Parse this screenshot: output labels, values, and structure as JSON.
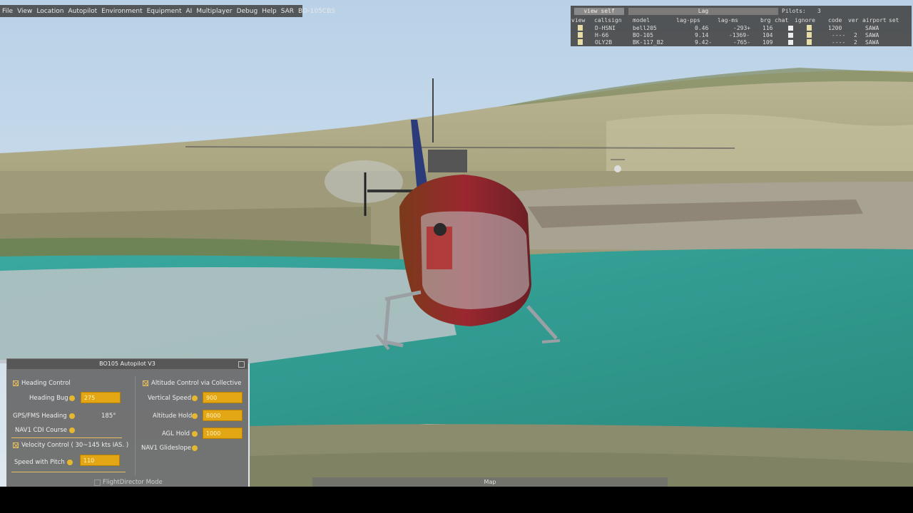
{
  "menu": [
    "File",
    "View",
    "Location",
    "Autopilot",
    "Environment",
    "Equipment",
    "AI",
    "Multiplayer",
    "Debug",
    "Help",
    "SAR",
    "BO-105CBS"
  ],
  "pilots_panel": {
    "view_self_label": "view self",
    "lag_label": "Lag",
    "pilots_label": "Pilots:",
    "pilots_count": "3",
    "columns": [
      "view",
      "callsign",
      "model",
      "lag-pps",
      "lag-ms",
      "brg",
      "chat",
      "ignore",
      "code",
      "ver",
      "airport",
      "set"
    ],
    "rows": [
      {
        "callsign": "D-HSNI",
        "model": "bell205",
        "lag_pps": "0.46",
        "lag_ms": "-293+",
        "brg": "116",
        "code": "1200",
        "ver": "",
        "airport": "SAWA"
      },
      {
        "callsign": "H-66",
        "model": "BO-105",
        "lag_pps": "9.14",
        "lag_ms": "-1369-",
        "brg": "104",
        "code": "----",
        "ver": "2",
        "airport": "SAWA"
      },
      {
        "callsign": "OLY2B",
        "model": "BK-117_B2",
        "lag_pps": "9.42-",
        "lag_ms": "-765-",
        "brg": "109",
        "code": "----",
        "ver": "2",
        "airport": "SAWA"
      }
    ]
  },
  "autopilot": {
    "title": "BO105 Autopilot V3",
    "heading_control": "Heading Control",
    "heading_bug_label": "Heading Bug",
    "heading_bug_value": "275",
    "gps_heading_label": "GPS/FMS Heading",
    "gps_heading_value": "185°",
    "nav1_cdi_label": "NAV1 CDI Course",
    "velocity_control": "Velocity Control ( 30~145 kts IAS. )",
    "speed_pitch_label": "Speed with Pitch",
    "speed_pitch_value": "110",
    "altitude_control": "Altitude Control via Collective",
    "vertical_speed_label": "Vertical Speed",
    "vertical_speed_value": "900",
    "altitude_hold_label": "Altitude Hold",
    "altitude_hold_value": "8000",
    "agl_hold_label": "AGL Hold",
    "agl_hold_value": "1000",
    "nav1_glideslope_label": "NAV1 Glideslope",
    "flight_director_label": "FlightDirector Mode"
  },
  "map_label": "Map",
  "colors": {
    "field": "#e3a614",
    "check": "#e8c060",
    "water": "#2f9c8e",
    "sky": "#c9dcec"
  }
}
